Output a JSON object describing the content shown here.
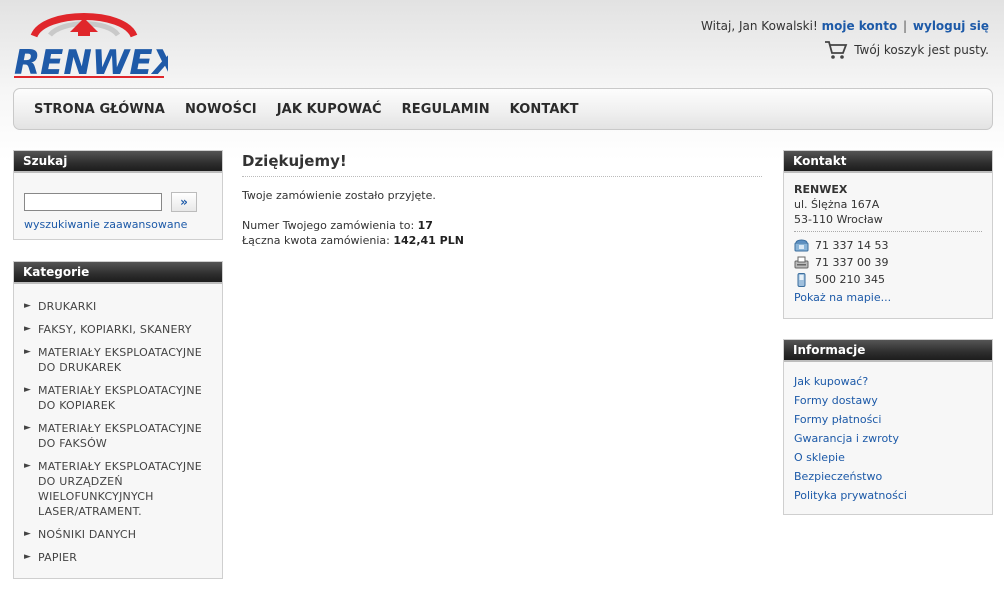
{
  "header": {
    "logo_text": "RENWEX",
    "greeting": "Witaj, Jan Kowalski!",
    "account_link": "moje konto",
    "separator": "|",
    "logout_link": "wyloguj się",
    "cart_text": "Twój koszyk jest pusty."
  },
  "nav": {
    "items": [
      "STRONA GŁÓWNA",
      "NOWOŚCI",
      "JAK KUPOWAĆ",
      "REGULAMIN",
      "KONTAKT"
    ]
  },
  "search": {
    "title": "Szukaj",
    "input_value": "",
    "button_label": "»",
    "advanced_link": "wyszukiwanie zaawansowane"
  },
  "categories": {
    "title": "Kategorie",
    "items": [
      "DRUKARKI",
      "FAKSY, KOPIARKI, SKANERY",
      "MATERIAŁY EKSPLOATACYJNE\nDO DRUKAREK",
      "MATERIAŁY EKSPLOATACYJNE\nDO KOPIAREK",
      "MATERIAŁY EKSPLOATACYJNE\nDO FAKSÓW",
      "MATERIAŁY EKSPLOATACYJNE\nDO URZĄDZEŃ\nWIELOFUNKCYJNYCH\nLASER/ATRAMENT.",
      "NOŚNIKI DANYCH",
      "PAPIER"
    ]
  },
  "main": {
    "title": "Dziękujemy!",
    "message": "Twoje zamówienie zostało przyjęte.",
    "order_label": "Numer Twojego zamówienia to:",
    "order_number": "17",
    "total_label": "Łączna kwota zamówienia:",
    "total_value": "142,41 PLN"
  },
  "contact": {
    "title": "Kontakt",
    "company": "RENWEX",
    "street": "ul. Ślężna 167A",
    "city": "53-110 Wrocław",
    "phone": "71 337 14 53",
    "fax": "71 337 00 39",
    "mobile": "500 210 345",
    "map_link": "Pokaż na mapie..."
  },
  "info": {
    "title": "Informacje",
    "items": [
      "Jak kupować?",
      "Formy dostawy",
      "Formy płatności",
      "Gwarancja i zwroty",
      "O sklepie",
      "Bezpieczeństwo",
      "Polityka prywatności"
    ]
  },
  "colors": {
    "brand_blue": "#1f5aa8",
    "brand_red": "#e0262b",
    "link": "#1d5aa8"
  }
}
